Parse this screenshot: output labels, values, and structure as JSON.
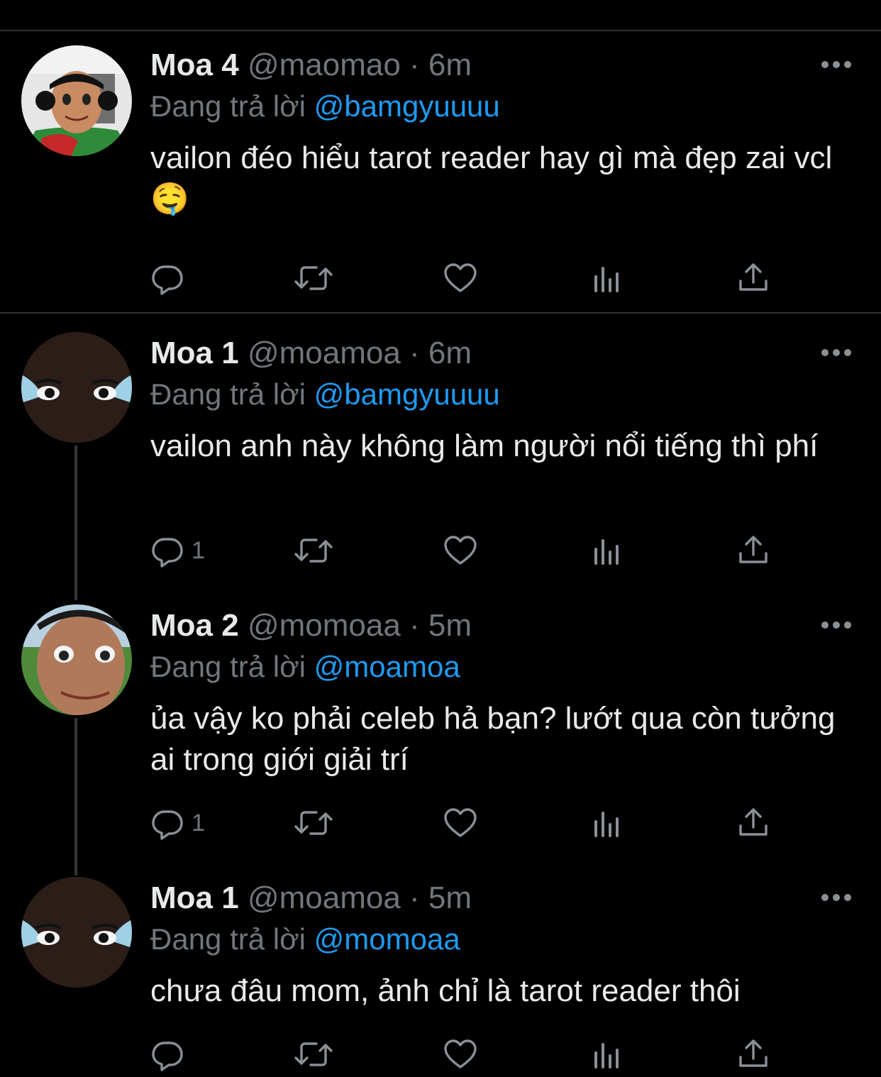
{
  "colors": {
    "background": "#000000",
    "text": "#e7e9ea",
    "muted": "#71767b",
    "mention": "#1d9bf0",
    "divider": "#2f3336"
  },
  "tweets": [
    {
      "name": "Moa 4",
      "handle": "@maomao",
      "separator": "·",
      "time": "6m",
      "reply_prefix": "Đang trả lời",
      "reply_to": "@bamgyuuuu",
      "text": "vailon đéo hiểu tarot reader hay gì mà đẹp zai vcl 🤤",
      "avatar": "avatar-moa4",
      "reply_count": "",
      "icons": [
        "reply-icon",
        "retweet-icon",
        "like-icon",
        "views-icon",
        "share-icon",
        "more-icon"
      ]
    },
    {
      "name": "Moa 1",
      "handle": "@moamoa",
      "separator": "·",
      "time": "6m",
      "reply_prefix": "Đang trả lời",
      "reply_to": "@bamgyuuuu",
      "text": "vailon anh này không làm người nổi tiếng thì phí",
      "avatar": "avatar-moa1",
      "reply_count": "1"
    },
    {
      "name": "Moa 2",
      "handle": "@momoaa",
      "separator": "·",
      "time": "5m",
      "reply_prefix": "Đang trả lời",
      "reply_to": "@moamoa",
      "text": "ủa vậy ko phải celeb hả bạn? lướt qua còn tưởng ai trong giới giải trí",
      "avatar": "avatar-moa2",
      "reply_count": "1"
    },
    {
      "name": "Moa 1",
      "handle": "@moamoa",
      "separator": "·",
      "time": "5m",
      "reply_prefix": "Đang trả lời",
      "reply_to": "@momoaa",
      "text": "chưa đâu mom, ảnh chỉ là tarot reader thôi",
      "avatar": "avatar-moa1",
      "reply_count": ""
    }
  ]
}
